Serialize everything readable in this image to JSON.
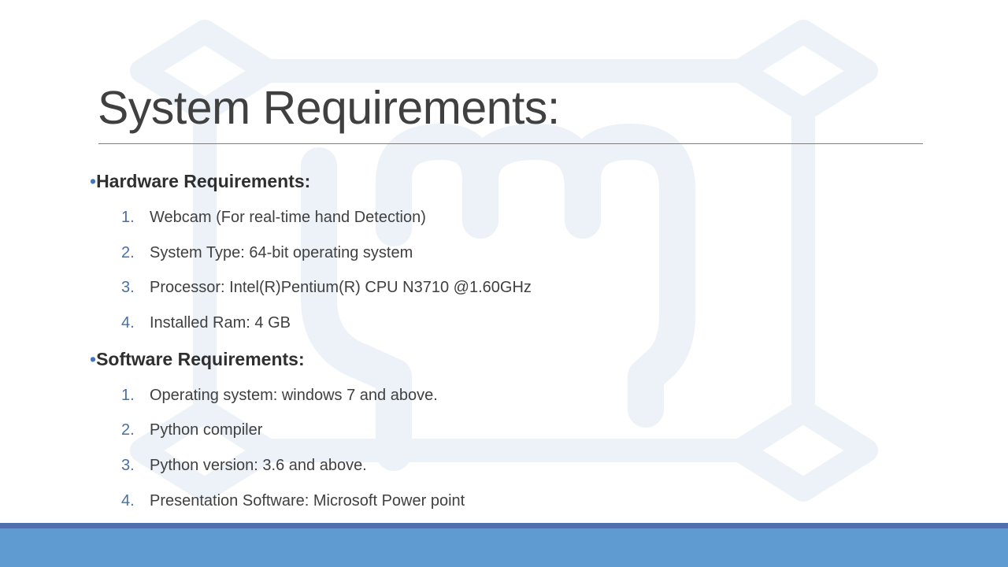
{
  "slide": {
    "title": "System Requirements:",
    "colors": {
      "title_text": "#404040",
      "body_text": "#404040",
      "bullet": "#4472c4",
      "number": "#4a6fa5",
      "footer_band": "#5f9bd0",
      "footer_line": "#4f6fae",
      "watermark": "#edf2f8"
    },
    "sections": [
      {
        "bullet": "•",
        "heading": "Hardware Requirements:",
        "items": [
          {
            "num": "1.",
            "text": "Webcam (For real-time hand Detection)"
          },
          {
            "num": "2.",
            "text": "System Type: 64-bit operating system"
          },
          {
            "num": "3.",
            "text": "Processor: Intel(R)Pentium(R) CPU N3710 @1.60GHz"
          },
          {
            "num": "4.",
            "text": "Installed Ram: 4 GB"
          }
        ]
      },
      {
        "bullet": "•",
        "heading": "Software Requirements:",
        "items": [
          {
            "num": "1.",
            "text": "Operating system: windows 7 and above."
          },
          {
            "num": "2.",
            "text": "Python compiler"
          },
          {
            "num": "3.",
            "text": "Python version: 3.6 and above."
          },
          {
            "num": "4.",
            "text": "Presentation Software: Microsoft Power point"
          }
        ]
      }
    ]
  }
}
